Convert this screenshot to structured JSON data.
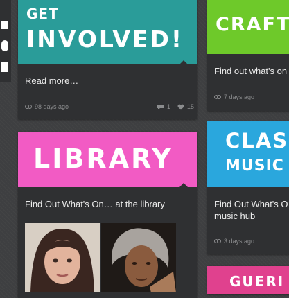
{
  "colors": {
    "teal": "#2a9c99",
    "green": "#6ec92a",
    "pink": "#f25bc4",
    "blue": "#2aa7dd",
    "magenta": "#e0418e"
  },
  "cards": {
    "get_involved": {
      "title_line1": "GET",
      "title_line2": "INVOLVED!",
      "text": "Read more…",
      "age": "98 days ago",
      "comments": "1",
      "likes": "15"
    },
    "craft": {
      "title": "CRAFT",
      "text": "Find out what's on",
      "age": "7 days ago"
    },
    "library": {
      "title": "LIBRARY",
      "text": "Find Out What's On… at the library"
    },
    "classical": {
      "title_line1": "CLAS",
      "title_line2": "MUSIC",
      "text_line1": "Find Out What's O",
      "text_line2": "music hub",
      "age": "3 days ago"
    },
    "guerilla": {
      "title": "GUERI"
    }
  }
}
